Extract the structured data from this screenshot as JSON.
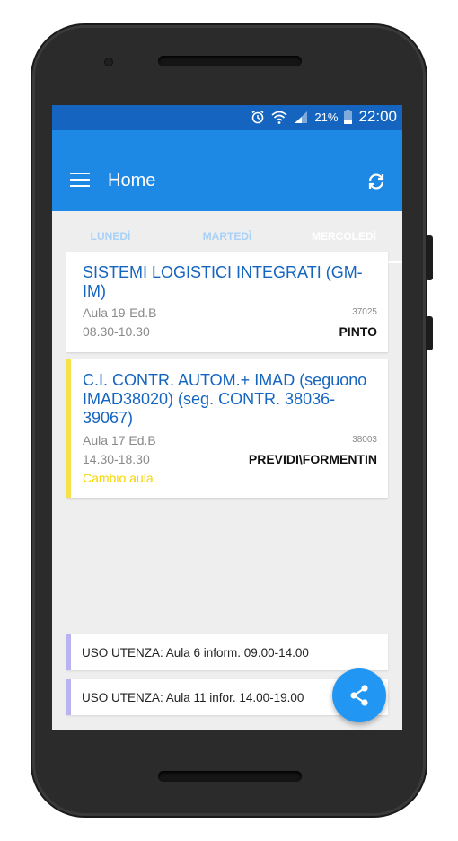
{
  "status": {
    "percent": "21%",
    "time": "22:00"
  },
  "appbar": {
    "title": "Home"
  },
  "tabs": [
    {
      "label": "LUNEDÌ",
      "active": false
    },
    {
      "label": "MARTEDÌ",
      "active": false
    },
    {
      "label": "MERCOLEDÌ",
      "active": true
    }
  ],
  "lessons": [
    {
      "subject": "SISTEMI LOGISTICI INTEGRATI (GM-IM)",
      "room": "Aula 19-Ed.B",
      "time": "08.30-10.30",
      "code": "37025",
      "professor": "PINTO"
    },
    {
      "subject": "C.I. CONTR. AUTOM.+ IMAD (seguono IMAD38020) (seg. CONTR. 38036-39067)",
      "room": "Aula 17 Ed.B",
      "time": "14.30-18.30",
      "code": "38003",
      "professor": "PREVIDI\\FORMENTIN",
      "note": "Cambio aula"
    }
  ],
  "uso": [
    {
      "text": "USO UTENZA:  Aula 6 inform. 09.00-14.00"
    },
    {
      "text": "USO UTENZA:  Aula 11 infor. 14.00-19.00"
    }
  ],
  "colors": {
    "primary": "#1e88e5",
    "status": "#1565c0",
    "accent": "#2196f3",
    "change_note": "#f4d500"
  },
  "icons": [
    "alarm-icon",
    "wifi-icon",
    "signal-icon",
    "battery-icon",
    "menu-icon",
    "refresh-icon",
    "share-icon"
  ]
}
